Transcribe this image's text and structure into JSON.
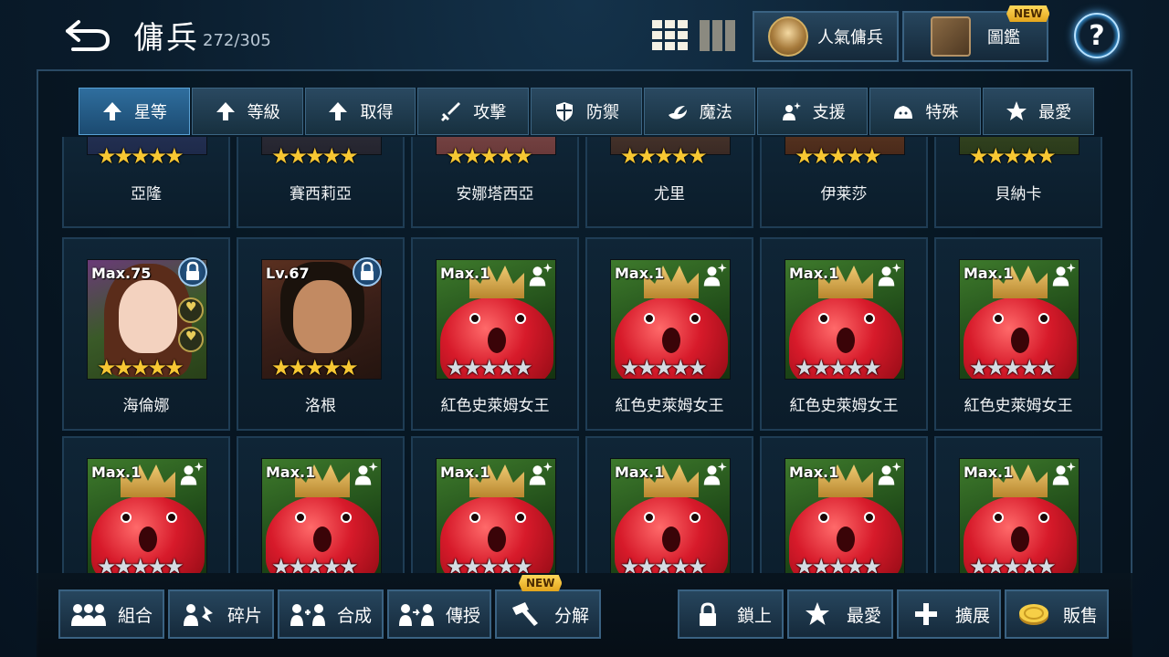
{
  "header": {
    "title": "傭兵",
    "count": "272/305",
    "popular_label": "人氣傭兵",
    "book_label": "圖鑑",
    "new_badge": "NEW",
    "help": "?"
  },
  "sort_tabs": [
    {
      "label": "星等",
      "icon": "arrow-up-icon",
      "active": true
    },
    {
      "label": "等級",
      "icon": "arrow-up-icon"
    },
    {
      "label": "取得",
      "icon": "arrow-up-icon"
    },
    {
      "label": "攻擊",
      "icon": "sword-icon"
    },
    {
      "label": "防禦",
      "icon": "shield-icon"
    },
    {
      "label": "魔法",
      "icon": "magic-icon"
    },
    {
      "label": "支援",
      "icon": "support-icon"
    },
    {
      "label": "特殊",
      "icon": "slime-icon"
    },
    {
      "label": "最愛",
      "icon": "star-icon"
    }
  ],
  "row1": [
    {
      "name": "亞隆",
      "stars": "★★★★★"
    },
    {
      "name": "賽西莉亞",
      "stars": "★★★★★"
    },
    {
      "name": "安娜塔西亞",
      "stars": "★★★★★"
    },
    {
      "name": "尤里",
      "stars": "★★★★★"
    },
    {
      "name": "伊莱莎",
      "stars": "★★★★★"
    },
    {
      "name": "貝納卡",
      "stars": "★★★★★"
    }
  ],
  "row2": [
    {
      "name": "海倫娜",
      "level": "Max.75",
      "stars": "★★★★★",
      "star_color": "gold",
      "locked": true
    },
    {
      "name": "洛根",
      "level": "Lv.67",
      "stars": "★★★★★",
      "star_color": "gold",
      "locked": true
    },
    {
      "name": "紅色史萊姆女王",
      "level": "Max.1",
      "stars": "★★★★★",
      "star_color": "silver"
    },
    {
      "name": "紅色史萊姆女王",
      "level": "Max.1",
      "stars": "★★★★★",
      "star_color": "silver"
    },
    {
      "name": "紅色史萊姆女王",
      "level": "Max.1",
      "stars": "★★★★★",
      "star_color": "silver"
    },
    {
      "name": "紅色史萊姆女王",
      "level": "Max.1",
      "stars": "★★★★★",
      "star_color": "silver"
    }
  ],
  "row3": [
    {
      "level": "Max.1",
      "stars": "★★★★★"
    },
    {
      "level": "Max.1",
      "stars": "★★★★★"
    },
    {
      "level": "Max.1",
      "stars": "★★★★★"
    },
    {
      "level": "Max.1",
      "stars": "★★★★★"
    },
    {
      "level": "Max.1",
      "stars": "★★★★★"
    },
    {
      "level": "Max.1",
      "stars": "★★★★★"
    }
  ],
  "actions": {
    "combine": "組合",
    "fragment": "碎片",
    "synthesize": "合成",
    "transfer": "傳授",
    "decompose": "分解",
    "decompose_badge": "NEW",
    "lock": "鎖上",
    "favorite": "最愛",
    "expand": "擴展",
    "sell": "販售"
  },
  "colors": {
    "accent": "#3aa0e8",
    "gold_star": "#f7c733",
    "silver_star": "#d5dbe2",
    "new_badge": "#ffd85a"
  }
}
